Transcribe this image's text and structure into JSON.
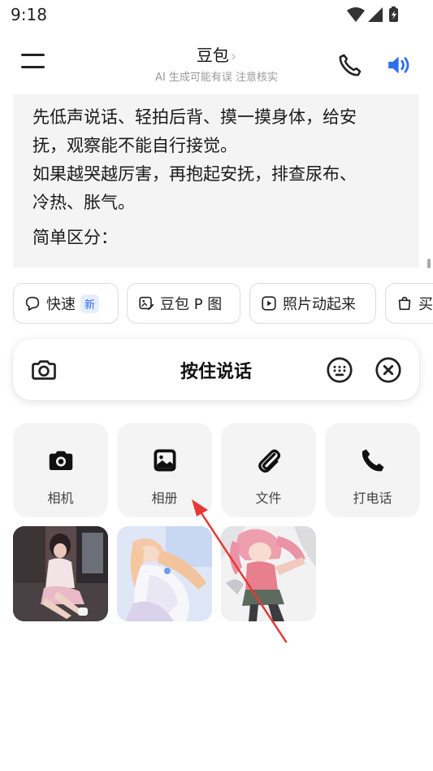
{
  "status_bar": {
    "time": "9:18"
  },
  "header": {
    "title": "豆包",
    "title_chevron": "›",
    "subtitle": "AI 生成可能有误 注意核实",
    "menu_icon": "hamburger-menu-icon",
    "phone_icon": "phone-icon",
    "speaker_icon": "speaker-icon",
    "accent_color": "#2f6fed"
  },
  "chat": {
    "lines": [
      "先低声说话、轻拍后背、摸一摸身体，给安",
      "抚，观察能不能自行接觉。",
      "如果越哭越厉害，再抱起安抚，排查尿布、",
      "冷热、胀气。",
      "简单区分："
    ]
  },
  "chips": [
    {
      "label": "快速",
      "badge": "新",
      "icon": "chat-bubble-icon"
    },
    {
      "label": "豆包 P 图",
      "icon": "image-edit-icon"
    },
    {
      "label": "照片动起来",
      "icon": "play-icon"
    },
    {
      "label": "买",
      "icon": "shopping-bag-icon"
    }
  ],
  "voice_bar": {
    "label": "按住说话",
    "camera_icon": "camera-icon",
    "keyboard_icon": "keyboard-icon",
    "close_icon": "close-icon"
  },
  "tiles": [
    {
      "label": "相机",
      "icon": "camera-icon"
    },
    {
      "label": "相册",
      "icon": "photo-album-icon"
    },
    {
      "label": "文件",
      "icon": "paperclip-icon"
    },
    {
      "label": "打电话",
      "icon": "phone-icon"
    }
  ],
  "recent_photos": [
    {
      "name": "recent-photo-1"
    },
    {
      "name": "recent-photo-2"
    },
    {
      "name": "recent-photo-3"
    }
  ]
}
